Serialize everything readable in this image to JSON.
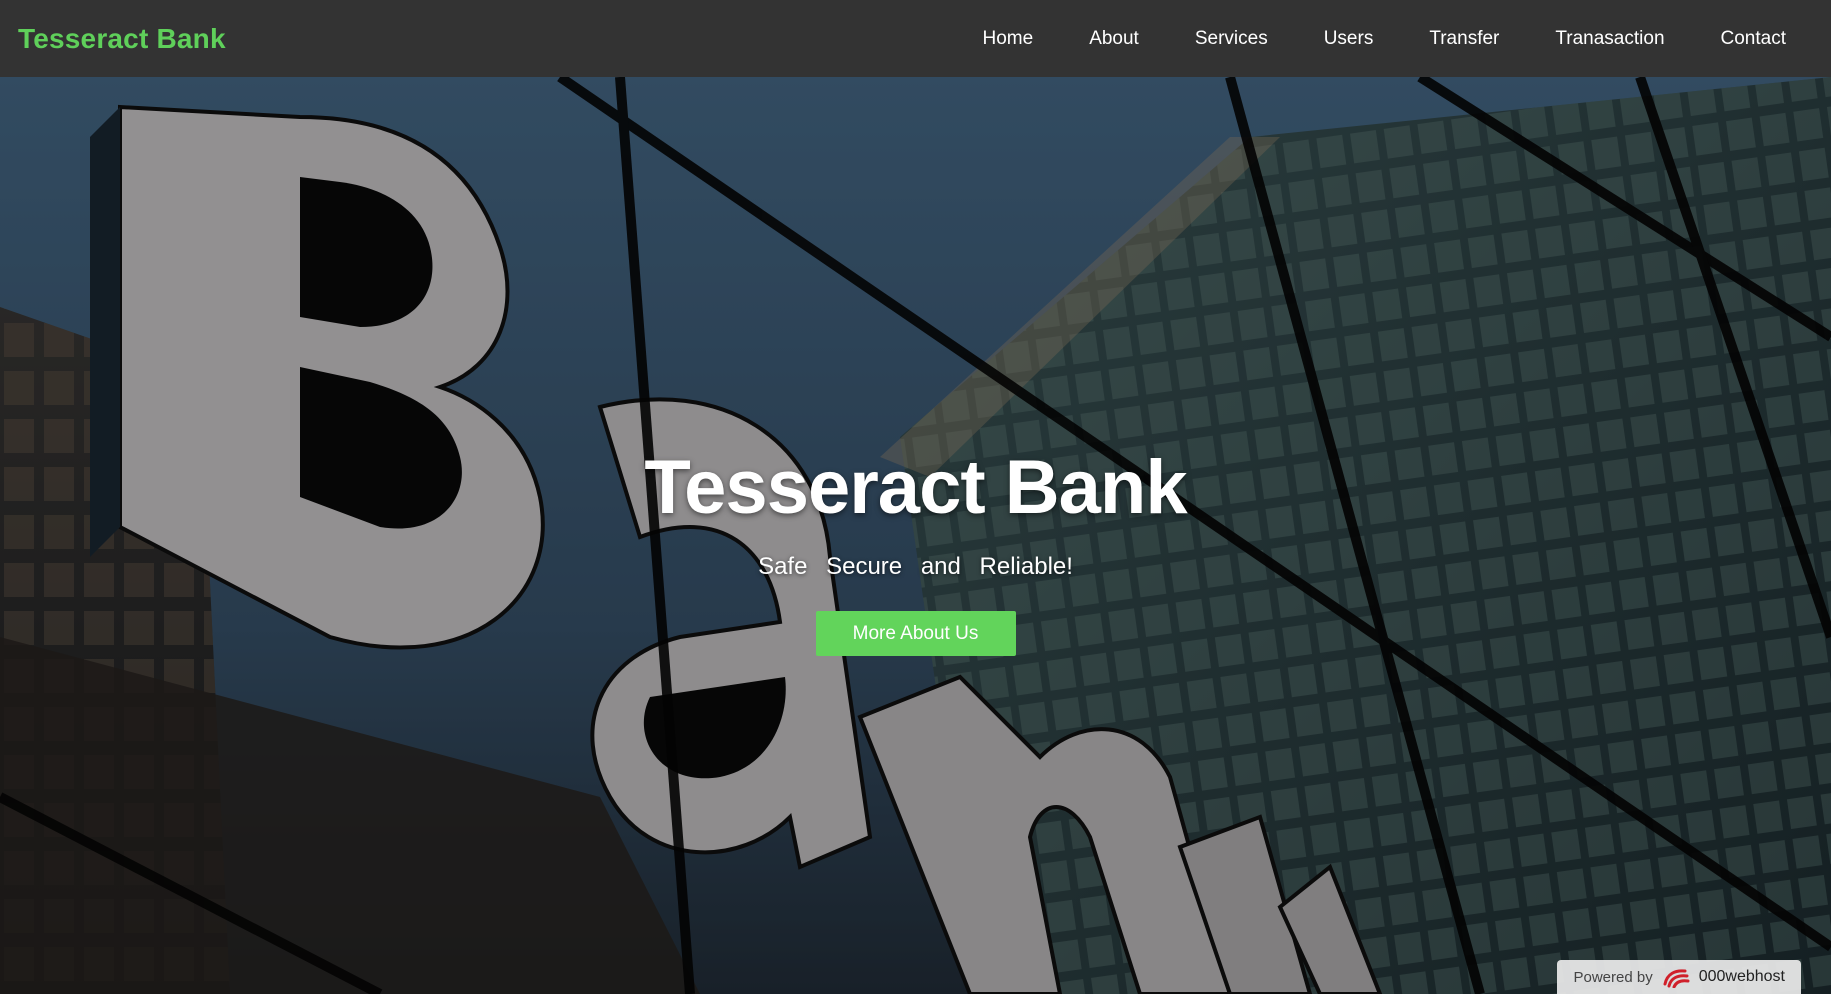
{
  "nav": {
    "brand": "Tesseract Bank",
    "links": [
      "Home",
      "About",
      "Services",
      "Users",
      "Transfer",
      "Tranasaction",
      "Contact"
    ]
  },
  "hero": {
    "title": "Tesseract Bank",
    "tagline": "Safe Secure and Reliable!",
    "button_label": "More About Us",
    "background_image": "bank-building-sign-photo"
  },
  "footer_badge": {
    "label": "Powered by",
    "brand": "000webhost",
    "icon": "000webhost-logo-icon"
  },
  "colors": {
    "navbar_bg": "#333333",
    "brand_green": "#5fd05a",
    "button_green": "#62d45b",
    "text_white": "#ffffff"
  }
}
